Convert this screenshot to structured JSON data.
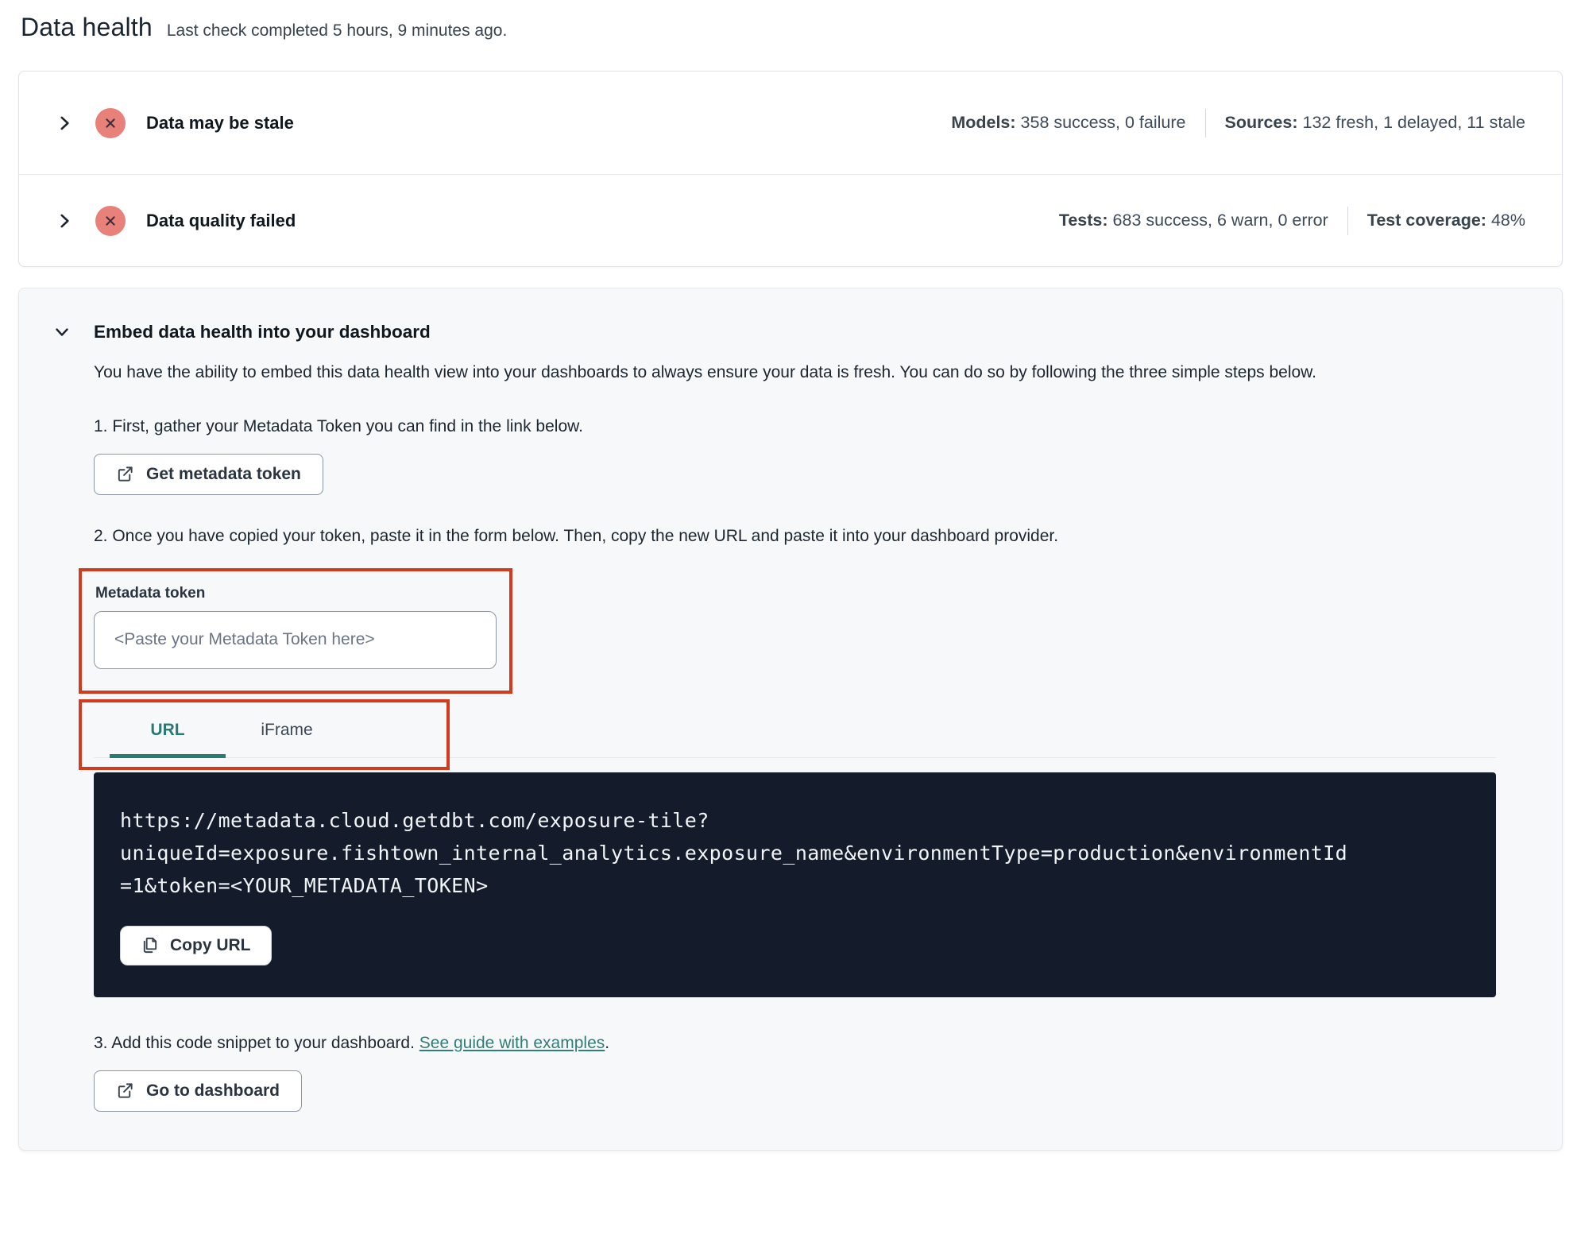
{
  "header": {
    "title": "Data health",
    "subtitle": "Last check completed 5 hours, 9 minutes ago."
  },
  "status_panels": [
    {
      "title": "Data may be stale",
      "icon": "error-circle-icon",
      "stats": [
        {
          "label": "Models:",
          "value": "358 success, 0 failure"
        },
        {
          "label": "Sources:",
          "value": "132 fresh, 1 delayed, 11 stale"
        }
      ]
    },
    {
      "title": "Data quality failed",
      "icon": "error-circle-icon",
      "stats": [
        {
          "label": "Tests:",
          "value": "683 success, 6 warn, 0 error"
        },
        {
          "label": "Test coverage:",
          "value": "48%"
        }
      ]
    }
  ],
  "embed": {
    "title": "Embed data health into your dashboard",
    "description": "You have the ability to embed this data health view into your dashboards to always ensure your data is fresh. You can do so by following the three simple steps below.",
    "step1": {
      "text": "1. First, gather your Metadata Token you can find in the link below.",
      "button_label": "Get metadata token"
    },
    "step2": {
      "text": "2. Once you have copied your token, paste it in the form below. Then, copy the new URL and paste it into your dashboard provider.",
      "token_label": "Metadata token",
      "token_placeholder": "<Paste your Metadata Token here>",
      "tabs": [
        {
          "label": "URL"
        },
        {
          "label": "iFrame"
        }
      ],
      "active_tab": "URL",
      "code_lines": [
        "https://metadata.cloud.getdbt.com/exposure-tile?",
        "uniqueId=exposure.fishtown_internal_analytics.exposure_name&environmentType=production&environmentId",
        "=1&token=<YOUR_METADATA_TOKEN>"
      ],
      "copy_button_label": "Copy URL"
    },
    "step3": {
      "text": "3. Add this code snippet to your dashboard. ",
      "link_label": "See guide with examples",
      "suffix": ".",
      "button_label": "Go to dashboard"
    }
  },
  "colors": {
    "highlight_red": "#d13b1e",
    "error_salmon": "#e8817a",
    "teal_accent": "#2a7a74",
    "code_background": "#141b2b"
  }
}
